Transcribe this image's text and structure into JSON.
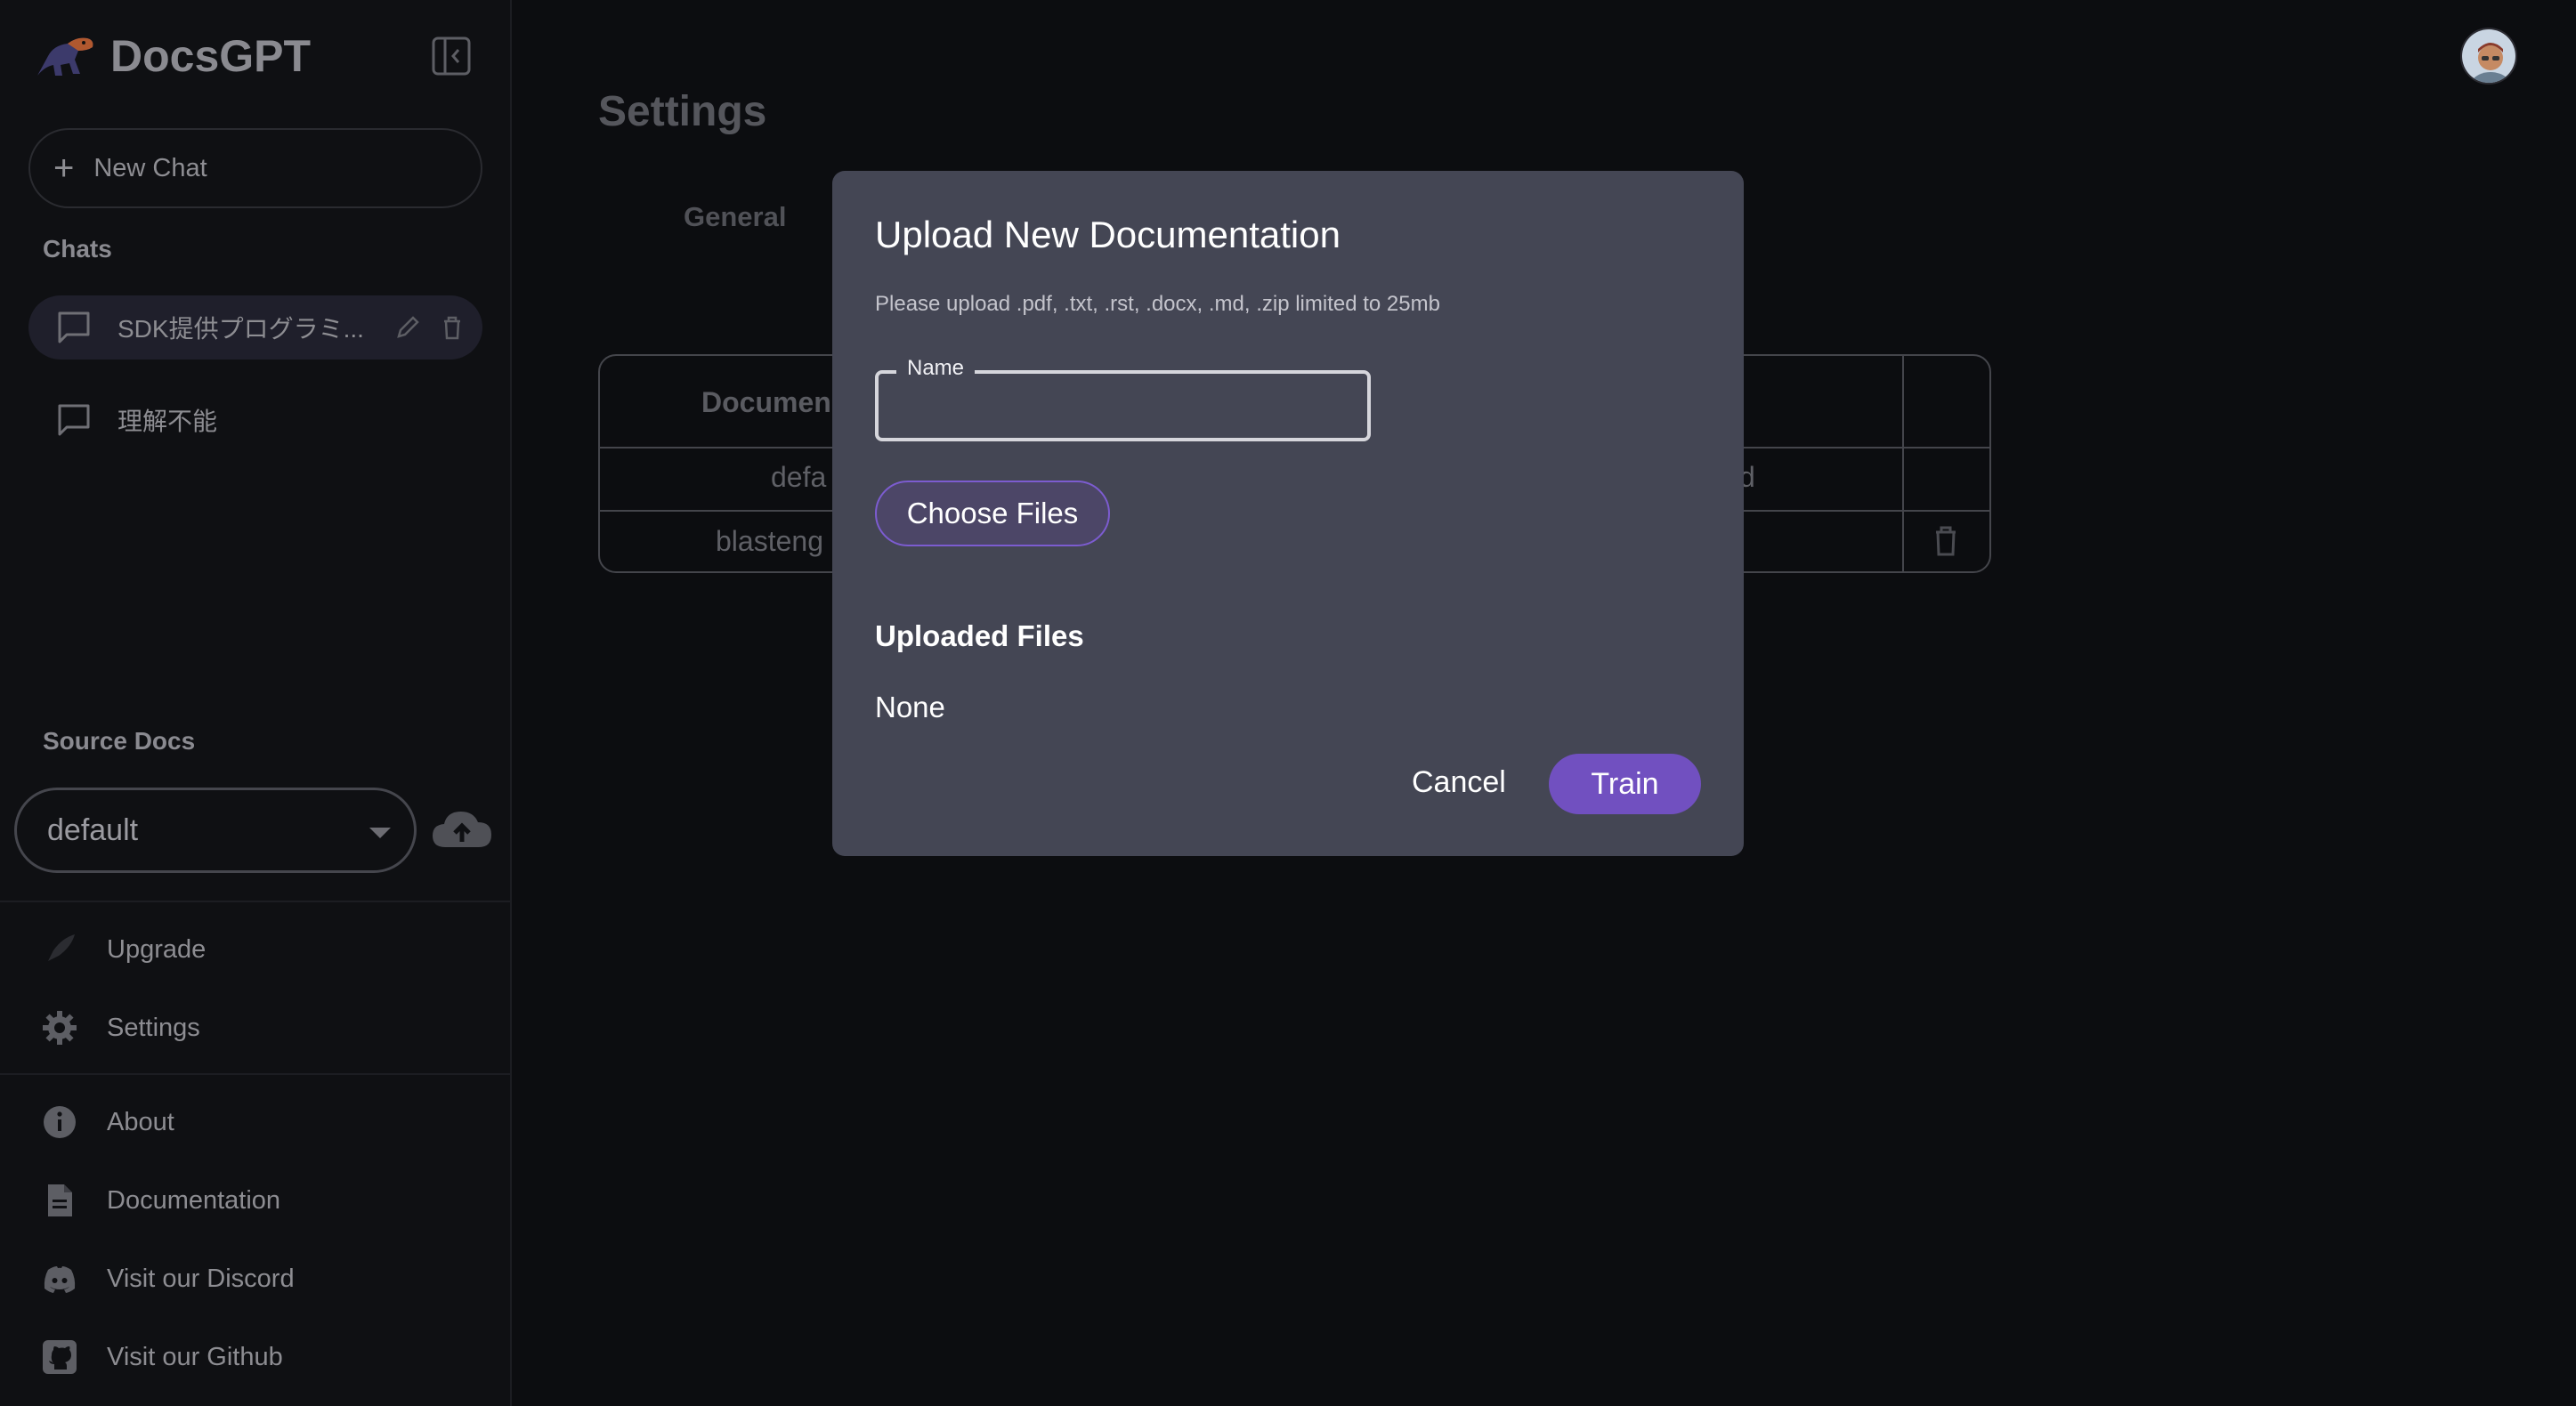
{
  "sidebar": {
    "brand": "DocsGPT",
    "new_chat_label": "New Chat",
    "chats_heading": "Chats",
    "chats": [
      {
        "label": "SDK提供プログラミ..."
      },
      {
        "label": "理解不能"
      }
    ],
    "source_docs_heading": "Source Docs",
    "source_selected": "default",
    "nav_top": [
      {
        "label": "Upgrade",
        "icon": "rocket-icon"
      },
      {
        "label": "Settings",
        "icon": "gear-icon"
      }
    ],
    "nav_bottom": [
      {
        "label": "About",
        "icon": "info-icon"
      },
      {
        "label": "Documentation",
        "icon": "document-icon"
      },
      {
        "label": "Visit our Discord",
        "icon": "discord-icon"
      },
      {
        "label": "Visit our Github",
        "icon": "github-icon"
      }
    ]
  },
  "main": {
    "title": "Settings",
    "tabs": [
      {
        "label": "General"
      }
    ],
    "table": {
      "header_visible": "Documen",
      "rows": [
        {
          "first_visible": "defa",
          "third_visible": "d"
        },
        {
          "first_visible": "blasteng"
        }
      ]
    }
  },
  "modal": {
    "title": "Upload New Documentation",
    "subtitle": "Please upload .pdf, .txt, .rst, .docx, .md, .zip limited to 25mb",
    "name_label": "Name",
    "name_value": "",
    "choose_files_label": "Choose Files",
    "uploaded_heading": "Uploaded Files",
    "uploaded_value": "None",
    "cancel_label": "Cancel",
    "train_label": "Train"
  },
  "colors": {
    "accent": "#7150c0",
    "modal_bg": "#444654",
    "page_bg": "#0c0d10"
  }
}
